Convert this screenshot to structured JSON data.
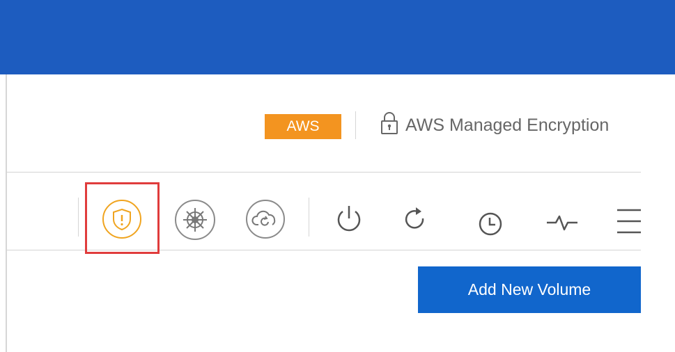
{
  "header": {
    "color": "#1d5cbf"
  },
  "cloud": {
    "provider_badge": "AWS",
    "provider_color": "#f39420",
    "encryption_label": "AWS Managed Encryption",
    "encryption_icon": "lock-icon"
  },
  "toolbar": {
    "highlight_color": "#e03c3c",
    "icons": [
      {
        "name": "shield-icon",
        "active": true,
        "color": "#f0a41f"
      },
      {
        "name": "kubernetes-helm-icon",
        "active": false
      },
      {
        "name": "cloud-sync-icon",
        "active": false
      },
      {
        "name": "power-icon",
        "active": false
      },
      {
        "name": "refresh-icon",
        "active": false
      },
      {
        "name": "clock-icon",
        "active": false
      },
      {
        "name": "activity-pulse-icon",
        "active": false
      },
      {
        "name": "hamburger-menu-icon",
        "active": false
      }
    ]
  },
  "actions": {
    "add_volume_label": "Add New Volume",
    "button_color": "#1166cc"
  }
}
